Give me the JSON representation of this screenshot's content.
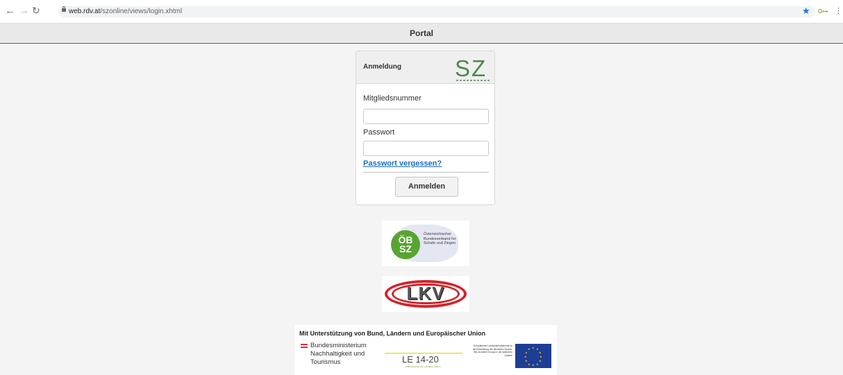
{
  "browser": {
    "url_domain": "web.rdv.at",
    "url_path": "/szonline/views/login.xhtml"
  },
  "portal": {
    "title": "Portal"
  },
  "login": {
    "title": "Anmeldung",
    "logo_text": "SZ",
    "member_label": "Mitgliedsnummer",
    "member_value": "",
    "password_label": "Passwort",
    "password_value": "",
    "forgot_link": "Passwort vergessen?",
    "submit_label": "Anmelden"
  },
  "logos": {
    "oebsz": {
      "circle_line1": "ÖB",
      "circle_line2": "SZ",
      "text": "Österreichischer Bundesverband für Schafe und Ziegen"
    },
    "lkv": {
      "text": "LKV"
    }
  },
  "funding": {
    "title": "Mit Unterstützung von Bund, Ländern und Europäischer Union",
    "ministry_line1": "Bundesministerium",
    "ministry_line2": "Nachhaltigkeit und",
    "ministry_line3": "Tourismus",
    "le_text": "LE 14-20",
    "le_sub": "Entwicklung für den Ländlichen Raum",
    "eu_text": "Europäischer Landwirtschaftsfonds für die Entwicklung des ländlichen Raums: Hier investiert Europa in die ländlichen Gebiete"
  }
}
